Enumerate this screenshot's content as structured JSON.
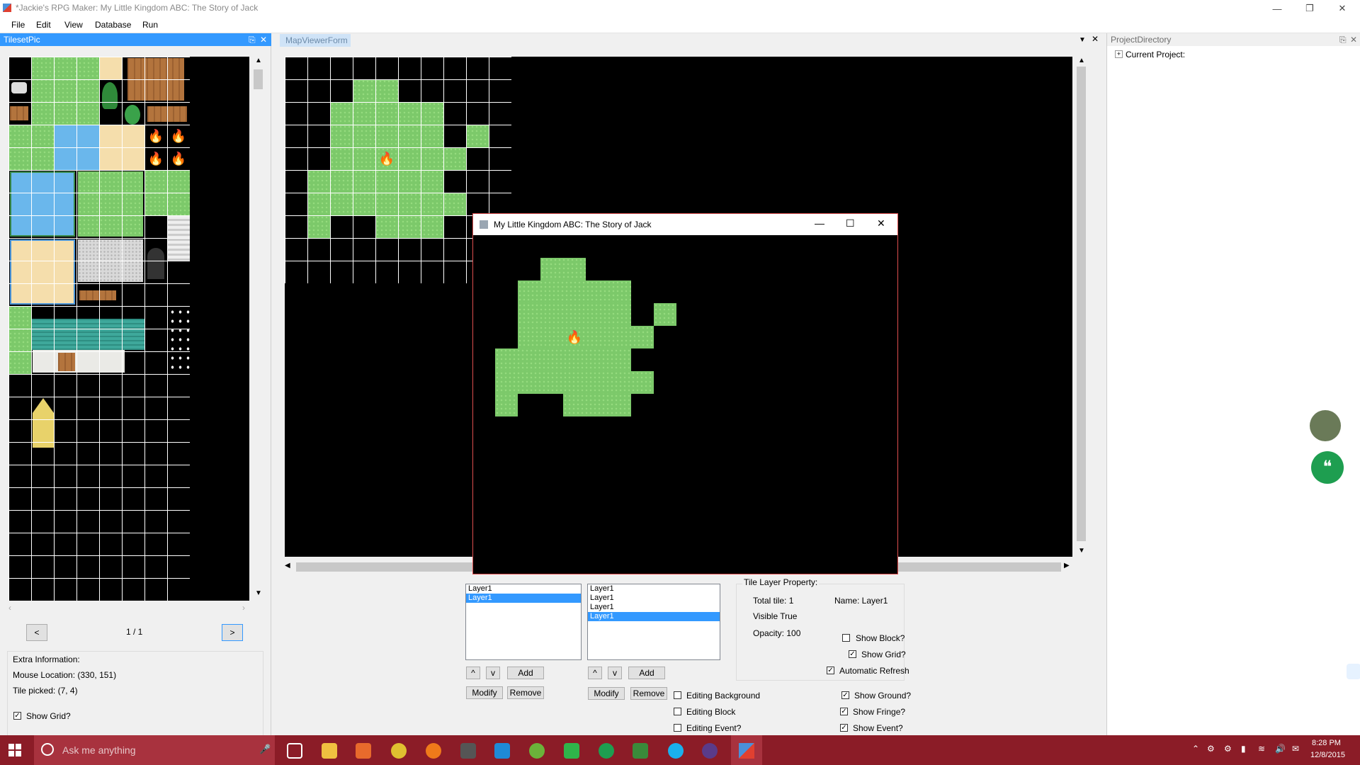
{
  "titlebar": {
    "title": "*Jackie's RPG Maker: My Little Kingdom ABC: The Story of Jack"
  },
  "menu": [
    "File",
    "Edit",
    "View",
    "Database",
    "Run"
  ],
  "left_panel": {
    "header": "TilesetPic",
    "page_indicator": "1 / 1",
    "prev_label": "<",
    "next_label": ">",
    "extra_info_title": "Extra Information:",
    "mouse_location": "Mouse Location: (330, 151)",
    "tile_picked": "Tile picked: (7, 4)",
    "show_grid_label": "Show Grid?",
    "show_grid_checked": true
  },
  "center": {
    "tab": "MapViewerForm",
    "game_window_title": "My Little Kingdom ABC: The Story of Jack",
    "list1": [
      {
        "label": "Layer1",
        "selected": false
      },
      {
        "label": "Layer1",
        "selected": true
      }
    ],
    "list2": [
      {
        "label": "Layer1",
        "selected": false
      },
      {
        "label": "Layer1",
        "selected": false
      },
      {
        "label": "Layer1",
        "selected": false
      },
      {
        "label": "Layer1",
        "selected": true
      }
    ],
    "up_label": "^",
    "down_label": "v",
    "add_label": "Add",
    "modify_label": "Modify",
    "remove_label": "Remove",
    "editing_background": "Editing Background",
    "editing_block": "Editing Block",
    "editing_event": "Editing Event?",
    "tile_layer_property": {
      "title": "Tile Layer Property:",
      "total_tile": "Total tile: 1",
      "name": "Name: Layer1",
      "visible": "Visible True",
      "opacity": "Opacity: 100",
      "show_block": "Show Block?",
      "show_grid": "Show Grid?",
      "automatic_refresh": "Automatic Refresh"
    },
    "show_ground": "Show Ground?",
    "show_fringe": "Show Fringe?",
    "show_event": "Show Event?"
  },
  "right_panel": {
    "header": "ProjectDirectory",
    "tree_root": "Current Project:"
  },
  "taskbar": {
    "search_placeholder": "Ask me anything",
    "time": "8:28 PM",
    "date": "12/8/2015"
  },
  "colors": {
    "accent": "#3399ff",
    "taskbar": "#8b1c27",
    "grass": "#7cc96a",
    "game_window_border": "#e05050"
  }
}
